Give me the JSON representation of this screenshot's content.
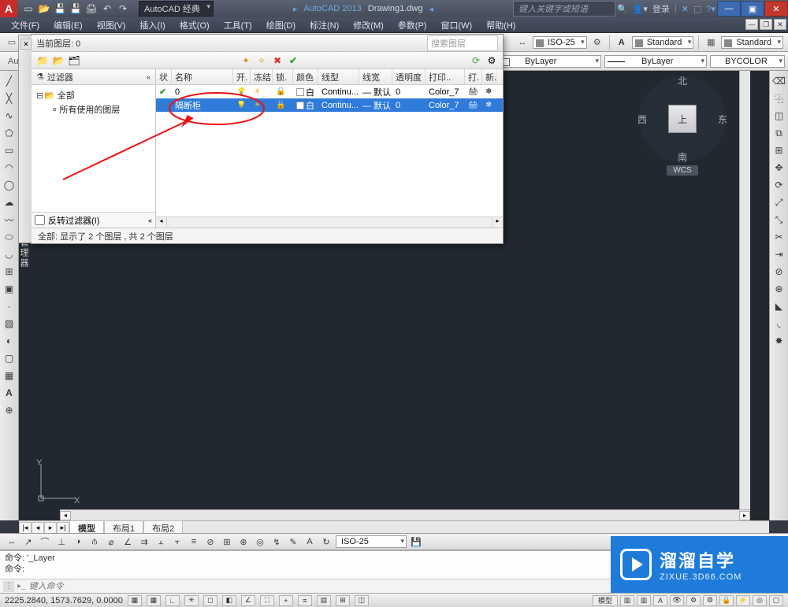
{
  "title": {
    "app": "AutoCAD 2013",
    "doc": "Drawing1.dwg"
  },
  "workspace": "AutoCAD 经典",
  "search_help_placeholder": "键入关键字或短语",
  "login_label": "登录",
  "menus": [
    "文件(F)",
    "编辑(E)",
    "视图(V)",
    "插入(I)",
    "格式(O)",
    "工具(T)",
    "绘图(D)",
    "标注(N)",
    "修改(M)",
    "参数(P)",
    "窗口(W)",
    "帮助(H)"
  ],
  "propbar": {
    "dimstyle": "ISO-25",
    "textstyle": "Standard",
    "tablestyle": "Standard"
  },
  "propbar2": {
    "layer_color": "ByLayer",
    "linetype": "ByLayer",
    "plotstyle": "BYCOLOR"
  },
  "viewcube": {
    "top": "北",
    "left": "西",
    "right": "东",
    "bottom": "南",
    "face": "上",
    "wcs": "WCS"
  },
  "tabs": {
    "model": "模型",
    "layout1": "布局1",
    "layout2": "布局2"
  },
  "bottom_combo": "ISO-25",
  "cmd": {
    "l1": "命令: '_Layer",
    "l2": "命令:",
    "placeholder": "键入命令"
  },
  "status": {
    "coords": "2225.2840, 1573.7629, 0.0000",
    "model_btn": "模型"
  },
  "lpm": {
    "current_layer_label": "当前图层: 0",
    "search_placeholder": "搜索图层",
    "filter_title": "过滤器",
    "tree_all": "全部",
    "tree_used": "所有使用的图层",
    "invert_label": "反转过滤器(I)",
    "columns": [
      "状",
      "名称",
      "开.",
      "冻结",
      "锁.",
      "颜色",
      "线型",
      "线宽",
      "透明度",
      "打印..",
      "打.",
      "新."
    ],
    "rows": [
      {
        "status": "✓",
        "name": "0",
        "on": true,
        "freeze": false,
        "lock": false,
        "color": "白",
        "linetype": "Continu...",
        "lineweight": "— 默认",
        "trans": "0",
        "plotstyle": "Color_7",
        "plot": true,
        "selected": false
      },
      {
        "status": "",
        "name": "隔断柜",
        "on": true,
        "freeze": false,
        "lock": false,
        "color": "白",
        "linetype": "Continu...",
        "lineweight": "— 默认",
        "trans": "0",
        "plotstyle": "Color_7",
        "plot": true,
        "selected": true
      }
    ],
    "footer": "全部: 显示了 2 个图层 , 共 2 个图层"
  },
  "watermark": {
    "t1": "溜溜自学",
    "t2": "ZIXUE.3D66.COM"
  }
}
